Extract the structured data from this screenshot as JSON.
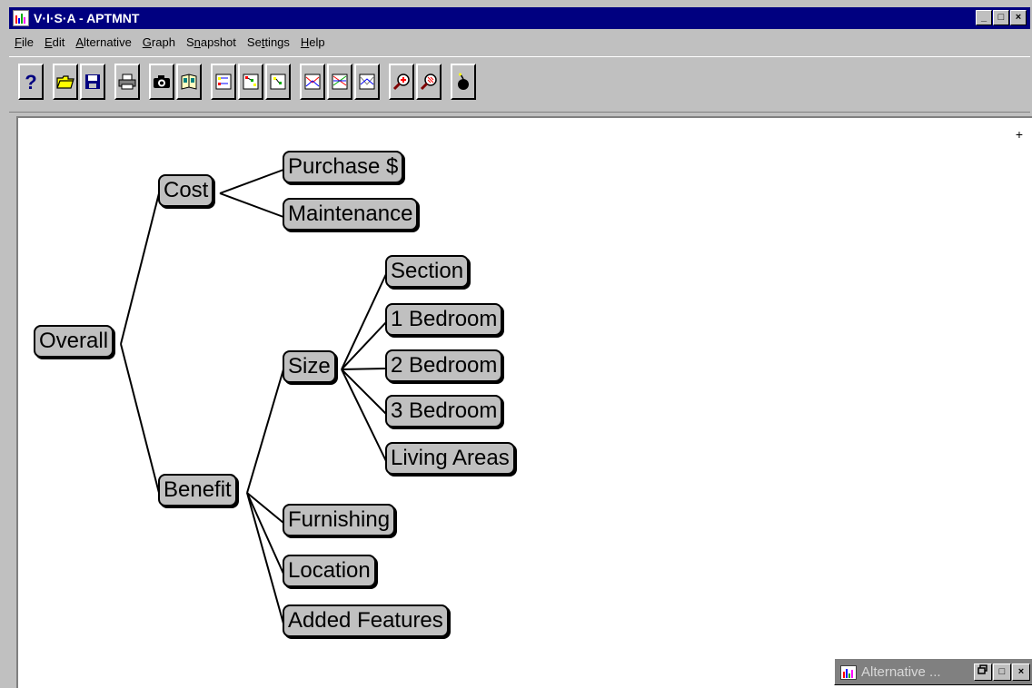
{
  "window": {
    "title": "V·I·S·A - APTMNT",
    "controls": {
      "minimize": "_",
      "maximize": "□",
      "close": "×"
    }
  },
  "menu": [
    {
      "label": "File",
      "mnemonic": "F",
      "rest": "ile"
    },
    {
      "label": "Edit",
      "mnemonic": "E",
      "rest": "dit"
    },
    {
      "label": "Alternative",
      "mnemonic": "A",
      "rest": "lternative"
    },
    {
      "label": "Graph",
      "mnemonic": "G",
      "rest": "raph"
    },
    {
      "label": "Snapshot",
      "pre": "S",
      "mnemonic": "n",
      "rest": "apshot"
    },
    {
      "label": "Settings",
      "pre": "Se",
      "mnemonic": "t",
      "rest": "tings"
    },
    {
      "label": "Help",
      "mnemonic": "H",
      "rest": "elp"
    }
  ],
  "toolbar_groups": [
    [
      "help-icon"
    ],
    [
      "open-folder-icon",
      "save-icon"
    ],
    [
      "print-icon"
    ],
    [
      "camera-icon",
      "snapshot-album-icon"
    ],
    [
      "graph-view-1-icon",
      "graph-view-2-icon",
      "graph-view-3-icon"
    ],
    [
      "chart-view-1-icon",
      "chart-view-2-icon",
      "chart-view-3-icon"
    ],
    [
      "zoom-in-icon",
      "zoom-out-icon"
    ],
    [
      "bomb-icon"
    ]
  ],
  "canvas": {
    "corner_mark": "+",
    "nodes": {
      "overall": "Overall",
      "cost": "Cost",
      "purchase": "Purchase $",
      "maintenance": "Maintenance",
      "benefit": "Benefit",
      "size": "Size",
      "section": "Section",
      "bed1": "1 Bedroom",
      "bed2": "2 Bedroom",
      "bed3": "3 Bedroom",
      "living": "Living Areas",
      "furnishing": "Furnishing",
      "location": "Location",
      "added": "Added Features"
    }
  },
  "minimized_window": {
    "title": "Alternative ..."
  },
  "colors": {
    "titlebar": "#000080",
    "face": "#c0c0c0",
    "canvas": "#ffffff"
  }
}
